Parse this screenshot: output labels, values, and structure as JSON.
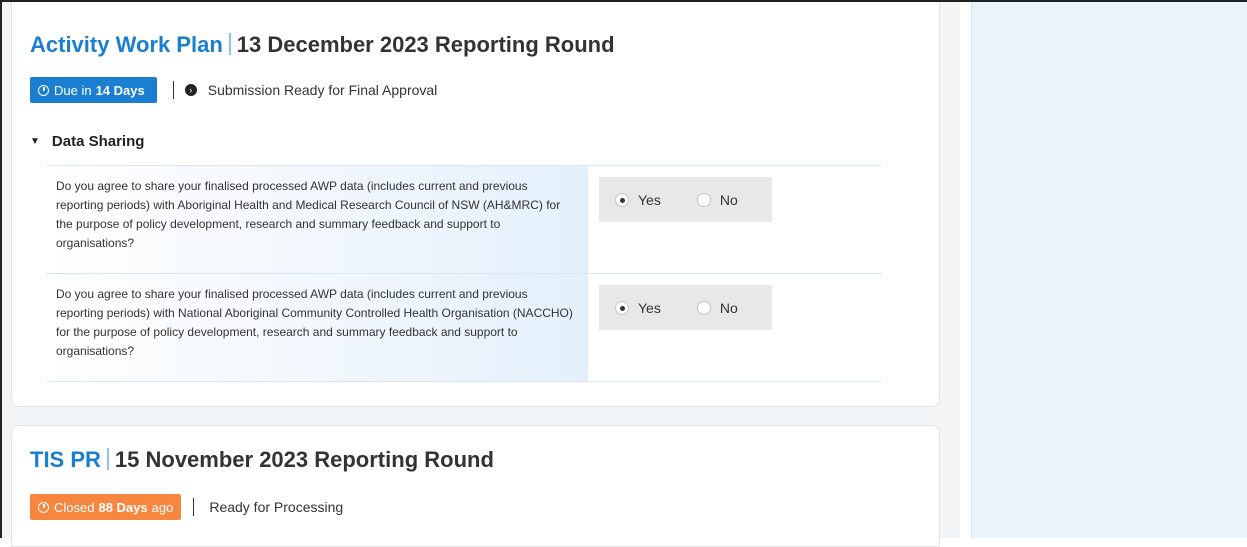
{
  "cards": [
    {
      "title_link": "Activity Work Plan",
      "title_rest": "13 December 2023 Reporting Round",
      "badge": {
        "prefix": "Due in",
        "count": "14 Days",
        "suffix": "",
        "color": "#1a7fd1"
      },
      "status": "Submission Ready for Final Approval",
      "section": {
        "title": "Data Sharing",
        "questions": [
          {
            "text": "Do you agree to share your finalised processed AWP data (includes current and previous reporting periods) with Aboriginal Health and Medical Research Council of NSW (AH&MRC) for the purpose of policy development, research and summary feedback and support to organisations?",
            "options": [
              "Yes",
              "No"
            ],
            "selected": "Yes"
          },
          {
            "text": "Do you agree to share your finalised processed AWP data (includes current and previous reporting periods) with National Aboriginal Community Controlled Health Organisation (NACCHO) for the purpose of policy development, research and summary feedback and support to organisations?",
            "options": [
              "Yes",
              "No"
            ],
            "selected": "Yes"
          }
        ]
      }
    },
    {
      "title_link": "TIS PR",
      "title_rest": "15 November 2023 Reporting Round",
      "badge": {
        "prefix": "Closed",
        "count": "88 Days",
        "suffix": "ago",
        "color": "#f7863f"
      },
      "status": "Ready for Processing"
    }
  ],
  "icons": {
    "clock": "clock-icon",
    "status_arrow": "chevron-right-circle-icon",
    "section_toggle": "caret-down-icon"
  }
}
